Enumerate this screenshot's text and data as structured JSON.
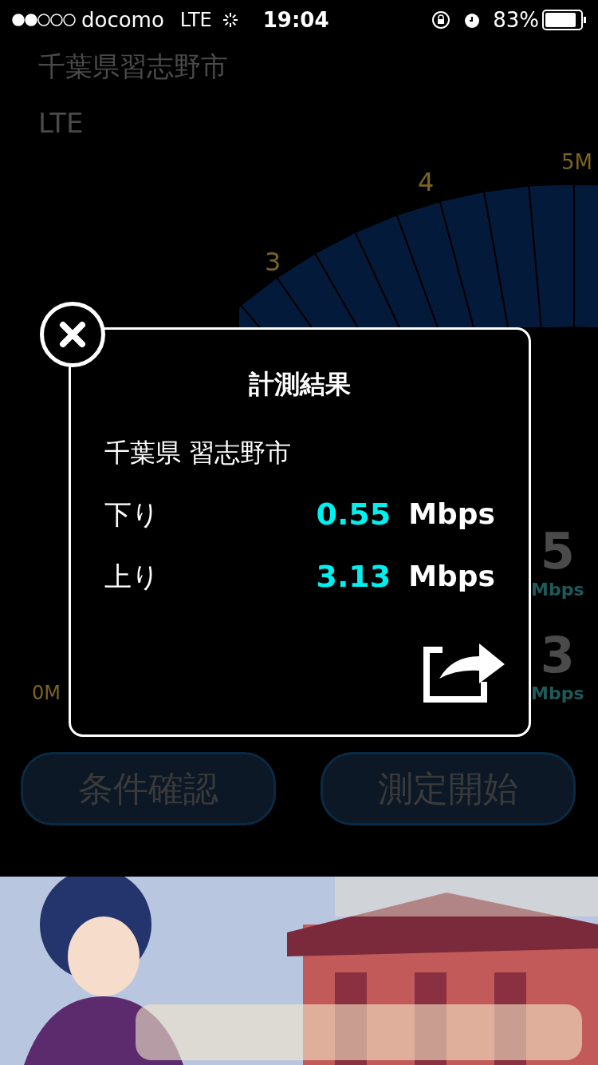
{
  "status_bar": {
    "carrier": "docomo",
    "network": "LTE",
    "time": "19:04",
    "battery": "83%"
  },
  "background": {
    "location": "千葉県習志野市",
    "network": "LTE",
    "gauge_labels": [
      "3",
      "4",
      "5M",
      "0M"
    ],
    "readings": [
      {
        "value": "5",
        "unit": "Mbps"
      },
      {
        "value": "3",
        "unit": "Mbps"
      }
    ],
    "buttons": [
      "条件確認",
      "測定開始"
    ]
  },
  "dialog": {
    "title": "計測結果",
    "location": "千葉県 習志野市",
    "rows": [
      {
        "label": "下り",
        "value": "0.55",
        "unit": "Mbps"
      },
      {
        "label": "上り",
        "value": "3.13",
        "unit": "Mbps"
      }
    ]
  }
}
